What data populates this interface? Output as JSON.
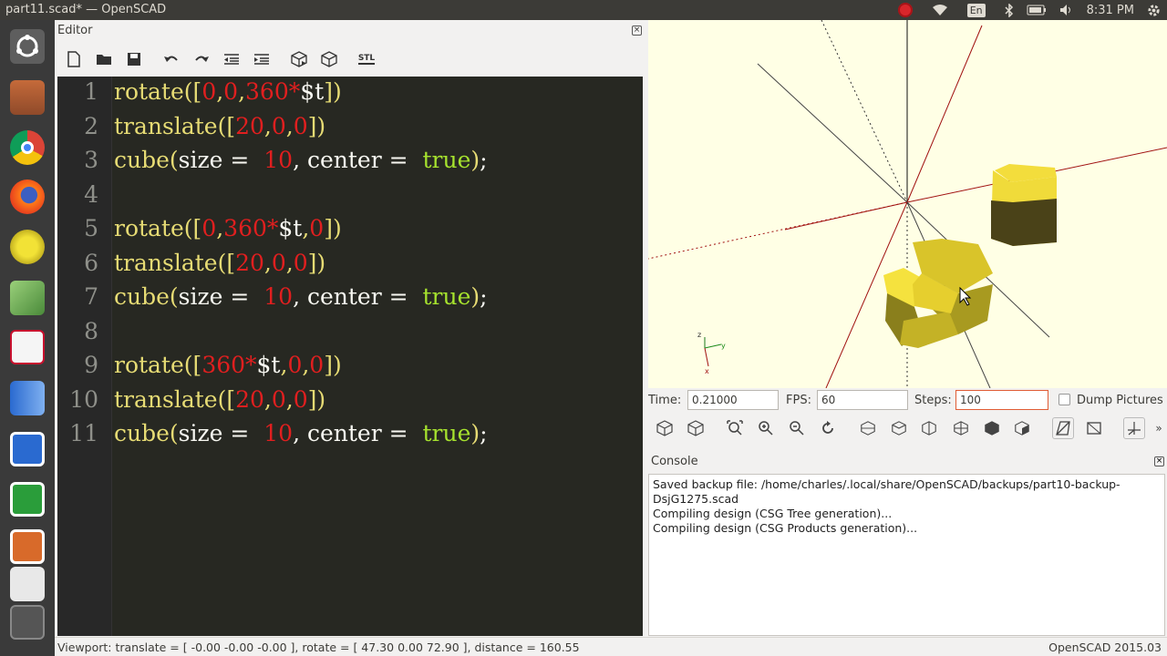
{
  "window": {
    "title": "part11.scad* — OpenSCAD"
  },
  "tray": {
    "keyboard": "En",
    "clock": "8:31 PM"
  },
  "editor": {
    "title": "Editor",
    "close": "×",
    "toolbar": {
      "export_label": "STL"
    },
    "lines": [
      {
        "n": "1",
        "tokens": [
          [
            "fn",
            "rotate"
          ],
          [
            "br",
            "(["
          ],
          [
            "num",
            "0"
          ],
          [
            "br",
            ","
          ],
          [
            "num",
            "0"
          ],
          [
            "br",
            ","
          ],
          [
            "num",
            "360"
          ],
          [
            "num",
            "*"
          ],
          [
            "var",
            "$t"
          ],
          [
            "br",
            "])"
          ]
        ]
      },
      {
        "n": "2",
        "tokens": [
          [
            "fn",
            "translate"
          ],
          [
            "br",
            "(["
          ],
          [
            "num",
            "20"
          ],
          [
            "br",
            ","
          ],
          [
            "num",
            "0"
          ],
          [
            "br",
            ","
          ],
          [
            "num",
            "0"
          ],
          [
            "br",
            "])"
          ]
        ]
      },
      {
        "n": "3",
        "tokens": [
          [
            "fn",
            "cube"
          ],
          [
            "br",
            "("
          ],
          [
            "var",
            "size "
          ],
          [
            "var",
            "= "
          ],
          [
            "num",
            " 10"
          ],
          [
            "var",
            ", center "
          ],
          [
            "var",
            "= "
          ],
          [
            "kw",
            " true"
          ],
          [
            "br",
            ")"
          ],
          [
            "var",
            ";"
          ]
        ]
      },
      {
        "n": "4",
        "tokens": []
      },
      {
        "n": "5",
        "tokens": [
          [
            "fn",
            "rotate"
          ],
          [
            "br",
            "(["
          ],
          [
            "num",
            "0"
          ],
          [
            "br",
            ","
          ],
          [
            "num",
            "360"
          ],
          [
            "num",
            "*"
          ],
          [
            "var",
            "$t"
          ],
          [
            "br",
            ","
          ],
          [
            "num",
            "0"
          ],
          [
            "br",
            "])"
          ]
        ]
      },
      {
        "n": "6",
        "tokens": [
          [
            "fn",
            "translate"
          ],
          [
            "br",
            "(["
          ],
          [
            "num",
            "20"
          ],
          [
            "br",
            ","
          ],
          [
            "num",
            "0"
          ],
          [
            "br",
            ","
          ],
          [
            "num",
            "0"
          ],
          [
            "br",
            "])"
          ]
        ]
      },
      {
        "n": "7",
        "tokens": [
          [
            "fn",
            "cube"
          ],
          [
            "br",
            "("
          ],
          [
            "var",
            "size "
          ],
          [
            "var",
            "= "
          ],
          [
            "num",
            " 10"
          ],
          [
            "var",
            ", center "
          ],
          [
            "var",
            "= "
          ],
          [
            "kw",
            " true"
          ],
          [
            "br",
            ")"
          ],
          [
            "var",
            ";"
          ]
        ]
      },
      {
        "n": "8",
        "tokens": []
      },
      {
        "n": "9",
        "tokens": [
          [
            "fn",
            "rotate"
          ],
          [
            "br",
            "(["
          ],
          [
            "num",
            "360"
          ],
          [
            "num",
            "*"
          ],
          [
            "var",
            "$t"
          ],
          [
            "br",
            ","
          ],
          [
            "num",
            "0"
          ],
          [
            "br",
            ","
          ],
          [
            "num",
            "0"
          ],
          [
            "br",
            "])"
          ]
        ]
      },
      {
        "n": "10",
        "tokens": [
          [
            "fn",
            "translate"
          ],
          [
            "br",
            "(["
          ],
          [
            "num",
            "20"
          ],
          [
            "br",
            ","
          ],
          [
            "num",
            "0"
          ],
          [
            "br",
            ","
          ],
          [
            "num",
            "0"
          ],
          [
            "br",
            "])"
          ]
        ]
      },
      {
        "n": "11",
        "tokens": [
          [
            "fn",
            "cube"
          ],
          [
            "br",
            "("
          ],
          [
            "var",
            "size "
          ],
          [
            "var",
            "= "
          ],
          [
            "num",
            " 10"
          ],
          [
            "var",
            ", center "
          ],
          [
            "var",
            "= "
          ],
          [
            "kw",
            " true"
          ],
          [
            "br",
            ")"
          ],
          [
            "var",
            ";"
          ]
        ]
      }
    ]
  },
  "animation": {
    "time_label": "Time:",
    "time_value": "0.21000",
    "fps_label": "FPS:",
    "fps_value": "60",
    "steps_label": "Steps:",
    "steps_value": "100",
    "dump_label": "Dump Pictures"
  },
  "console": {
    "title": "Console",
    "close": "×",
    "lines": [
      "Saved backup file: /home/charles/.local/share/OpenSCAD/backups/part10-backup-",
      "DsjG1275.scad",
      "Compiling design (CSG Tree generation)...",
      "Compiling design (CSG Products generation)..."
    ]
  },
  "status": {
    "viewport": "Viewport: translate = [ -0.00 -0.00 -0.00 ], rotate = [ 47.30 0.00 72.90 ], distance = 160.55",
    "version": "OpenSCAD 2015.03"
  },
  "colors": {
    "code_bg": "#272822",
    "viewport_bg": "#ffffe5",
    "cube_face": "#e6cf2e"
  }
}
